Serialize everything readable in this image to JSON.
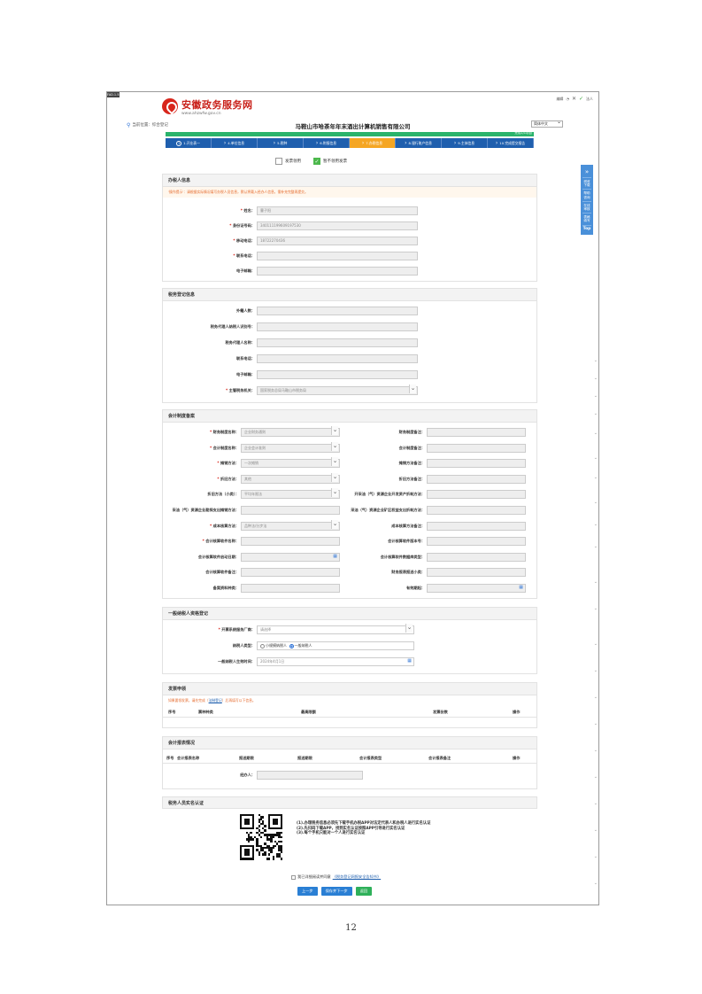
{
  "header": {
    "corner_tag": "FAD.1.55",
    "logo_title": "安徽政务服务网",
    "logo_url": "www.ahzwfw.gov.cn",
    "top_right": [
      "编辑",
      "法人"
    ],
    "crumb_label": "当前位置：",
    "crumb_value": "综合登记",
    "company": "马鞍山市哈茶年年末酒出计算机销售有限公司",
    "lang": "简体中文"
  },
  "progress": {
    "percent": 100,
    "label": "完成1/1项目"
  },
  "steps": [
    {
      "num": "1",
      "label": "1.开业表一",
      "active": false
    },
    {
      "num": "",
      "label": "4.单位信息",
      "active": false
    },
    {
      "num": "",
      "label": "5.税种",
      "active": false
    },
    {
      "num": "",
      "label": "6.附报信息",
      "active": false
    },
    {
      "num": "",
      "label": "7.办税信息",
      "active": true
    },
    {
      "num": "",
      "label": "8.银行账户信息",
      "active": false
    },
    {
      "num": "",
      "label": "9.主体信息",
      "active": false
    },
    {
      "num": "",
      "label": "10.完成提交报告",
      "active": false
    }
  ],
  "checks": {
    "invoice": "发票领用",
    "not_needed": "暂不领用发票"
  },
  "side_tab": [
    "税收下载",
    "帮助咨询",
    "在线审核",
    "表格填写",
    "Top"
  ],
  "handler": {
    "title": "办税人信息",
    "notice": "'操作提示'：请根据实际情况填写办税人员信息，默认将载入经办人信息，需补充完整再提交。",
    "fields": [
      {
        "label": "姓名：",
        "value": "曹子阳",
        "required": true
      },
      {
        "label": "身份证号码：",
        "value": "340111199609197530",
        "required": true
      },
      {
        "label": "移动电话：",
        "value": "18722270436",
        "required": true
      },
      {
        "label": "联系电话：",
        "value": "",
        "required": true
      },
      {
        "label": "电子邮箱：",
        "value": "",
        "required": false
      }
    ]
  },
  "tax_reg": {
    "title": "税务登记信息",
    "fields": [
      {
        "label": "外籍人数：",
        "value": "",
        "required": false,
        "type": "text"
      },
      {
        "label": "税务代理人纳税人识别号：",
        "value": "",
        "required": false,
        "type": "text"
      },
      {
        "label": "税务代理人名称：",
        "value": "",
        "required": false,
        "type": "text"
      },
      {
        "label": "联系电话：",
        "value": "",
        "required": false,
        "type": "text"
      },
      {
        "label": "电子邮箱：",
        "value": "",
        "required": false,
        "type": "text"
      },
      {
        "label": "主管税务机关：",
        "value": "国家税务总局马鞍山市税务局",
        "required": true,
        "type": "select"
      }
    ]
  },
  "accounting": {
    "title": "会计制度备案",
    "left": [
      {
        "label": "财务制度名称：",
        "value": "企业财务通则",
        "required": true,
        "type": "select"
      },
      {
        "label": "会计制度名称：",
        "value": "企业会计准则",
        "required": true,
        "type": "select"
      },
      {
        "label": "摊销方法：",
        "value": "一次摊销",
        "required": true,
        "type": "select"
      },
      {
        "label": "折旧方法：",
        "value": "其他",
        "required": true,
        "type": "select"
      },
      {
        "label": "折旧方法（小类）：",
        "value": "平均年限法",
        "required": false,
        "type": "select"
      },
      {
        "label": "采油（气）资源企业勘探支出摊销方法：",
        "value": "",
        "required": false,
        "type": "text"
      },
      {
        "label": "成本核算方法：",
        "value": "品种法/分步法",
        "required": true,
        "type": "select"
      },
      {
        "label": "会计核算软件名称：",
        "value": "",
        "required": true,
        "type": "text"
      },
      {
        "label": "会计核算软件启动日期：",
        "value": "",
        "required": false,
        "type": "cal"
      },
      {
        "label": "会计核算软件备注：",
        "value": "",
        "required": false,
        "type": "text"
      },
      {
        "label": "备案资料种类：",
        "value": "",
        "required": false,
        "type": "text"
      }
    ],
    "right": [
      {
        "label": "财务制度备注：",
        "value": "",
        "type": "text"
      },
      {
        "label": "会计制度备注：",
        "value": "",
        "type": "text"
      },
      {
        "label": "摊销方法备注：",
        "value": "",
        "type": "text"
      },
      {
        "label": "折旧方法备注：",
        "value": "",
        "type": "text"
      },
      {
        "label": "开采油（气）资源企业开发资产折耗方法：",
        "value": "",
        "type": "text"
      },
      {
        "label": "采油（气）资源企业矿区权益支出折耗方法：",
        "value": "",
        "type": "text"
      },
      {
        "label": "成本核算方法备注：",
        "value": "",
        "type": "text"
      },
      {
        "label": "会计核算软件版本号：",
        "value": "",
        "type": "text"
      },
      {
        "label": "会计核算软件数据库类型：",
        "value": "",
        "type": "text"
      },
      {
        "label": "财务报表报送小类：",
        "value": "",
        "type": "text"
      },
      {
        "label": "有效期起：",
        "value": "",
        "type": "cal"
      }
    ]
  },
  "general_taxpayer": {
    "title": "一般纳税人资格登记",
    "vendor_label": "开票系统服务厂商：",
    "vendor_value": "请选择",
    "type_label": "纳税人类型：",
    "type_small": "小规模纳税人",
    "type_general": "一般纳税人",
    "date_label": "一般纳税人生效时间：",
    "date_value": "2024年4月1日"
  },
  "invoice": {
    "title": "发票申领",
    "notice_pre": "如果要领发票，请先完成（",
    "notice_link": "法制登记",
    "notice_post": "）后再填写以下信息。",
    "columns": [
      "序号",
      "票种种类",
      "最高限额",
      "发票份数",
      "操作"
    ]
  },
  "reports": {
    "title": "会计报表情况",
    "columns": [
      "序号",
      "会计报表名称",
      "报送期限",
      "报送期限",
      "会计报表类型",
      "会计报表备注",
      "操作"
    ],
    "handler_label": "经办人："
  },
  "realname": {
    "title": "税务人员实名认证",
    "lines": [
      "(1).办理税务信息必须先下载手机办税APP对法定代表人和办税人进行实名认证",
      "(2).先扫码下载APP，找到实名认证按照APP引导进行实名认证",
      "(3).每个手机只能对一个人进行实名认证"
    ]
  },
  "agree": {
    "text": "我已详细阅读并同意",
    "link": "《税务登记网报安全告知书》"
  },
  "buttons": {
    "prev": "上一步",
    "save_next": "保存并下一步",
    "back": "返回"
  },
  "page_number": "12",
  "colors": {
    "brand_red": "#d8261c",
    "step_blue": "#1f5fae",
    "step_active": "#f5a623",
    "progress_green": "#2ab36b"
  }
}
